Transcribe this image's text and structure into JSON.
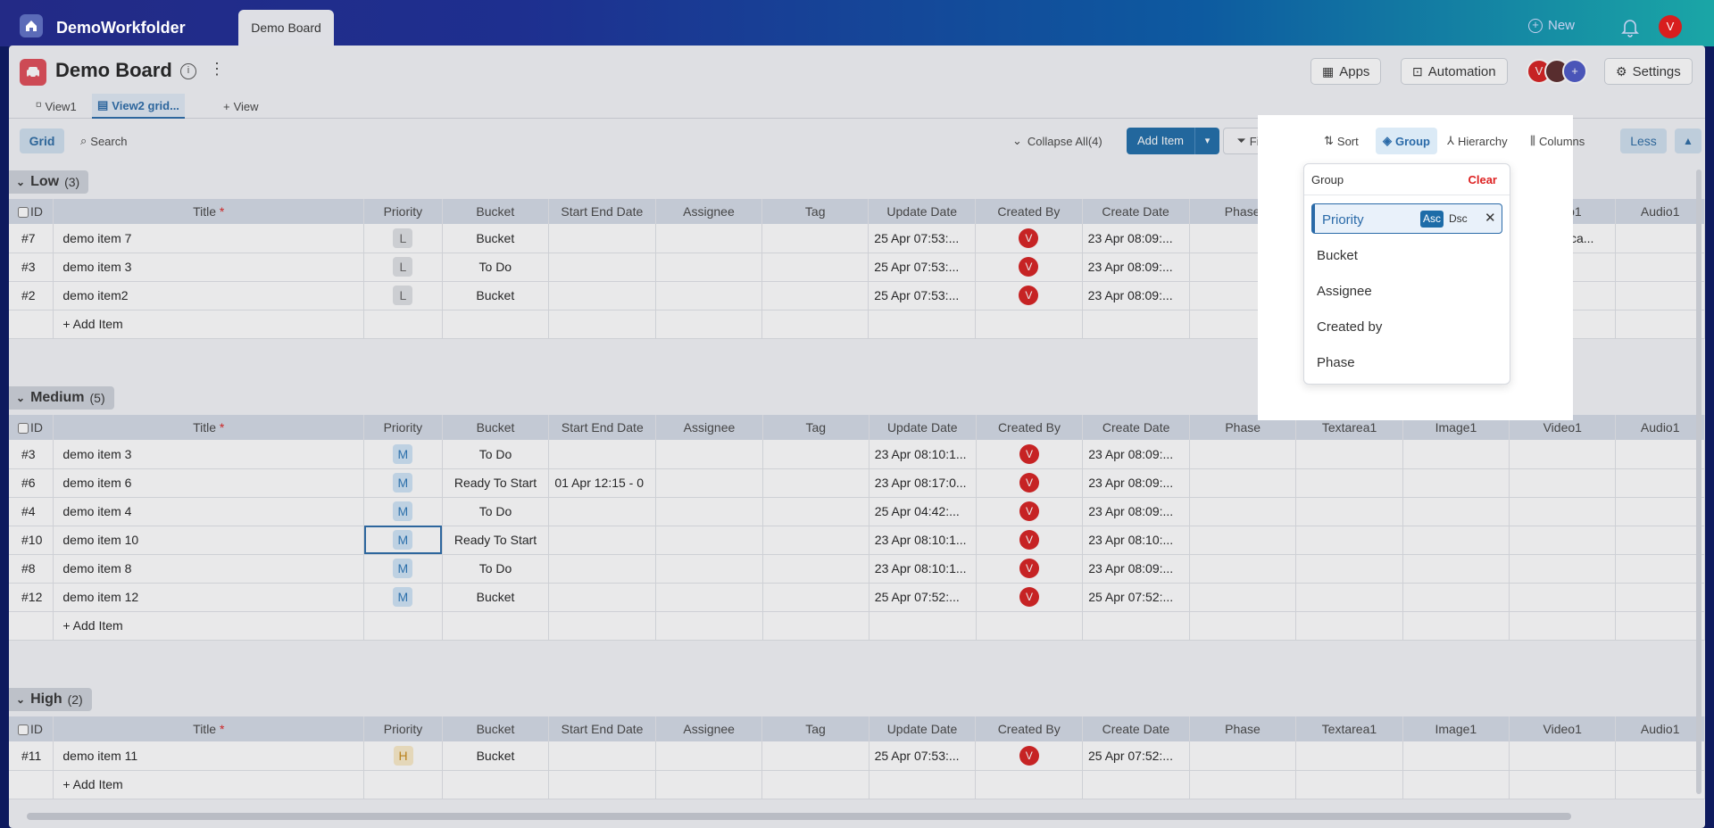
{
  "topbar": {
    "workspace": "DemoWorkfolder",
    "tab": "Demo Board",
    "new_label": "New",
    "avatar": "V"
  },
  "header": {
    "title": "Demo Board",
    "apps_label": "Apps",
    "automation_label": "Automation",
    "settings_label": "Settings",
    "avatar_letter": "V"
  },
  "view_tabs": [
    "View1",
    "View2 grid...",
    "View"
  ],
  "toolbar": {
    "grid": "Grid",
    "search": "Search",
    "collapse": "Collapse All(4)",
    "add_item": "Add Item",
    "filter": "Filter",
    "sort": "Sort",
    "group": "Group",
    "hierarchy": "Hierarchy",
    "columns": "Columns",
    "less": "Less"
  },
  "columns": [
    "ID",
    "Title",
    "Priority",
    "Bucket",
    "Start End Date",
    "Assignee",
    "Tag",
    "Update Date",
    "Created By",
    "Create Date",
    "Phase",
    "Textarea1",
    "Image1",
    "Video1",
    "Audio1"
  ],
  "add_row_label": "+ Add Item",
  "groups": [
    {
      "name": "Low",
      "count": "(3)",
      "rows": [
        {
          "id": "#7",
          "title": "demo item 7",
          "priority": "L",
          "bucket": "Bucket",
          "dates": "",
          "update": "25 Apr 07:53:...",
          "created_by": "V",
          "create": "23 Apr 08:09:...",
          "video": "Screenca..."
        },
        {
          "id": "#3",
          "title": "demo item 3",
          "priority": "L",
          "bucket": "To Do",
          "dates": "",
          "update": "25 Apr 07:53:...",
          "created_by": "V",
          "create": "23 Apr 08:09:...",
          "video": ""
        },
        {
          "id": "#2",
          "title": "demo item2",
          "priority": "L",
          "bucket": "Bucket",
          "dates": "",
          "update": "25 Apr 07:53:...",
          "created_by": "V",
          "create": "23 Apr 08:09:...",
          "video": ""
        }
      ]
    },
    {
      "name": "Medium",
      "count": "(5)",
      "rows": [
        {
          "id": "#3",
          "title": "demo item 3",
          "priority": "M",
          "bucket": "To Do",
          "dates": "",
          "update": "23 Apr 08:10:1...",
          "created_by": "V",
          "create": "23 Apr 08:09:...",
          "video": ""
        },
        {
          "id": "#6",
          "title": "demo item 6",
          "priority": "M",
          "bucket": "Ready To Start",
          "dates": "01 Apr 12:15  -  0",
          "update": "23 Apr 08:17:0...",
          "created_by": "V",
          "create": "23 Apr 08:09:...",
          "video": ""
        },
        {
          "id": "#4",
          "title": "demo item 4",
          "priority": "M",
          "bucket": "To Do",
          "dates": "",
          "update": "25 Apr 04:42:...",
          "created_by": "V",
          "create": "23 Apr 08:09:...",
          "video": ""
        },
        {
          "id": "#10",
          "title": "demo item 10",
          "priority": "M",
          "bucket": "Ready To Start",
          "dates": "",
          "update": "23 Apr 08:10:1...",
          "created_by": "V",
          "create": "23 Apr 08:10:...",
          "video": ""
        },
        {
          "id": "#8",
          "title": "demo item 8",
          "priority": "M",
          "bucket": "To Do",
          "dates": "",
          "update": "23 Apr 08:10:1...",
          "created_by": "V",
          "create": "23 Apr 08:09:...",
          "video": ""
        },
        {
          "id": "#12",
          "title": "demo item 12",
          "priority": "M",
          "bucket": "Bucket",
          "dates": "",
          "update": "25 Apr 07:52:...",
          "created_by": "V",
          "create": "25 Apr 07:52:...",
          "video": ""
        }
      ]
    },
    {
      "name": "High",
      "count": "(2)",
      "rows": [
        {
          "id": "#11",
          "title": "demo item 11",
          "priority": "H",
          "bucket": "Bucket",
          "dates": "",
          "update": "25 Apr 07:53:...",
          "created_by": "V",
          "create": "25 Apr 07:52:...",
          "video": ""
        }
      ]
    }
  ],
  "group_popup": {
    "header": "Group",
    "clear": "Clear",
    "selected": "Priority",
    "asc": "Asc",
    "dsc": "Dsc",
    "options": [
      "Bucket",
      "Assignee",
      "Created by",
      "Phase"
    ]
  },
  "colors": {
    "accent": "#1d6ca8",
    "danger": "#d81e1e"
  }
}
